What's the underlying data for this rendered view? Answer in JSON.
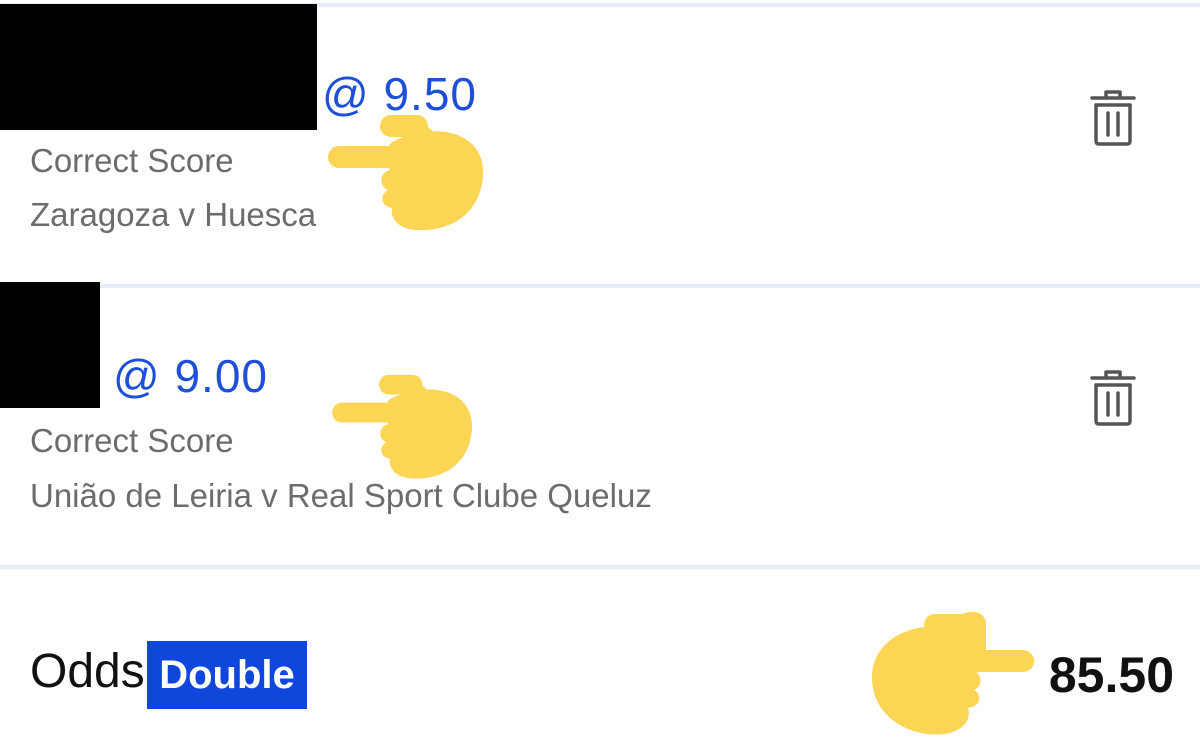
{
  "selections": [
    {
      "odds": "@ 9.50",
      "market": "Correct Score",
      "event": "Zaragoza v Huesca",
      "delete_icon": "trash-icon",
      "pointer_icon": "pointing-hand-icon"
    },
    {
      "odds": "@ 9.00",
      "market": "Correct Score",
      "event": "União de Leiria v Real Sport Clube Queluz",
      "delete_icon": "trash-icon",
      "pointer_icon": "pointing-hand-icon"
    }
  ],
  "summary": {
    "odds_label": "Odds",
    "bet_type": "Double",
    "total_odds": "85.50",
    "pointer_icon": "pointing-hand-icon"
  },
  "colors": {
    "accent_blue": "#1e4fd8",
    "badge_blue": "#0f47dc",
    "hand_yellow": "#fcd554",
    "redaction": "#000000",
    "divider": "#e8eef9"
  }
}
